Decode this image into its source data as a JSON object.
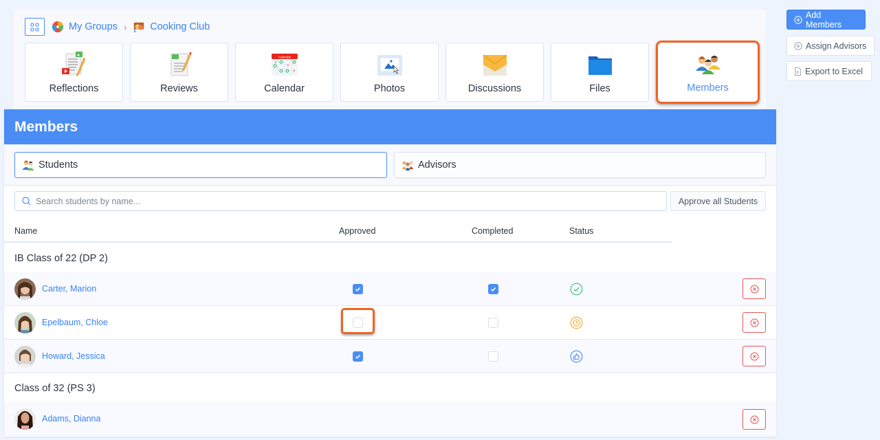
{
  "breadcrumb": {
    "grid_icon": "apps-grid-icon",
    "items": [
      {
        "label": "My Groups",
        "icon": "groups-wheel-icon"
      },
      {
        "label": "Cooking Club",
        "icon": "theater-masks-icon"
      }
    ],
    "separator": "›"
  },
  "tiles": [
    {
      "label": "Reflections",
      "icon": "reflection-document-icon",
      "active": false
    },
    {
      "label": "Reviews",
      "icon": "review-notepad-icon",
      "active": false
    },
    {
      "label": "Calendar",
      "icon": "calendar-icon",
      "active": false
    },
    {
      "label": "Photos",
      "icon": "photo-icon",
      "active": false
    },
    {
      "label": "Discussions",
      "icon": "envelope-icon",
      "active": false
    },
    {
      "label": "Files",
      "icon": "folder-icon",
      "active": false
    },
    {
      "label": "Members",
      "icon": "members-group-icon",
      "active": true
    }
  ],
  "side_actions": {
    "add_members": "Add Members",
    "assign_advisors": "Assign Advisors",
    "export_excel": "Export to Excel"
  },
  "panel": {
    "title": "Members",
    "segments": {
      "students": "Students",
      "advisors": "Advisors",
      "selected": "Students"
    },
    "search": {
      "placeholder": "Search students by name...",
      "value": ""
    },
    "approve_all_label": "Approve all Students",
    "columns": [
      "Name",
      "Approved",
      "Completed",
      "Status"
    ],
    "groups": [
      {
        "title": "IB Class of 22 (DP 2)",
        "members": [
          {
            "name": "Carter, Marion",
            "approved": true,
            "completed": true,
            "status": "completed",
            "status_icon": "check-circle-icon",
            "status_color": "#3cc47c"
          },
          {
            "name": "Epelbaum, Chloe",
            "approved": false,
            "completed": false,
            "status": "pending",
            "status_icon": "clock-circle-icon",
            "status_color": "#f5a623"
          },
          {
            "name": "Howard, Jessica",
            "approved": true,
            "completed": false,
            "status": "approved",
            "status_icon": "thumbs-up-circle-icon",
            "status_color": "#4a8ef5"
          }
        ]
      },
      {
        "title": "Class of 32 (PS 3)",
        "members": [
          {
            "name": "Adams, Dianna",
            "approved": null,
            "completed": null,
            "status": null
          }
        ]
      }
    ]
  },
  "colors": {
    "accent": "#4a8ef5",
    "highlight": "#f26321",
    "danger": "#e8585a",
    "link": "#3b82f0"
  }
}
